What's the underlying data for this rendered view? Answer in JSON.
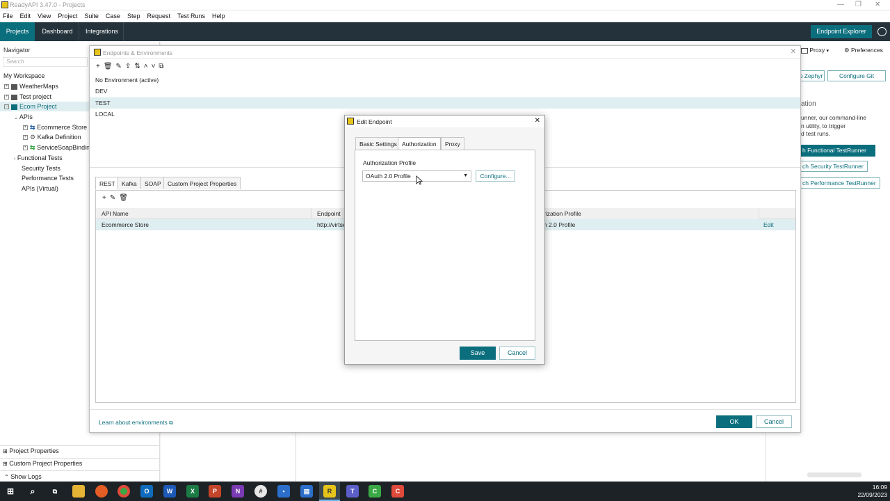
{
  "window": {
    "title": "ReadyAPI 3.47.0 - Projects"
  },
  "menu": [
    "File",
    "Edit",
    "View",
    "Project",
    "Suite",
    "Case",
    "Step",
    "Request",
    "Test Runs",
    "Help"
  ],
  "topnav": {
    "tabs": [
      "Projects",
      "Dashboard",
      "Integrations"
    ],
    "endpoint_explorer": "Endpoint Explorer"
  },
  "navigator": {
    "title": "Navigator",
    "search_placeholder": "Search",
    "workspace": "My Workspace",
    "projects": [
      "WeatherMaps",
      "Test project",
      "Ecom Project"
    ],
    "apis_label": "APIs",
    "apis": [
      "Ecommerce Store",
      "Kafka Definition",
      "ServiceSoapBindin"
    ],
    "sections": [
      "Functional Tests",
      "Security Tests",
      "Performance Tests",
      "APIs (Virtual)"
    ],
    "bottom": [
      "Project Properties",
      "Custom Project Properties",
      "Show Logs"
    ]
  },
  "right_panel": {
    "proxy": "Proxy",
    "preferences": "Preferences",
    "zephyr": "o Zephyr",
    "configure_git": "Configure Git",
    "heading": "ation",
    "text": [
      "unner, our command-line",
      "n utility, to trigger",
      "d test runs."
    ],
    "buttons": [
      "h Functional TestRunner",
      "ch Security TestRunner",
      "ch Performance TestRunner"
    ]
  },
  "ee_dialog": {
    "title": "Endpoints & Environments",
    "environments": [
      "No Environment (active)",
      "DEV",
      "TEST",
      "LOCAL"
    ],
    "tabs": [
      "REST",
      "Kafka",
      "SOAP",
      "Custom Project Properties"
    ],
    "columns": [
      "API Name",
      "Endpoint",
      "rization Profile"
    ],
    "row": {
      "api": "Ecommerce Store",
      "endpoint": "http://virtse",
      "profile": "h 2.0 Profile",
      "edit": "Edit"
    },
    "learn": "Learn about environments",
    "ok": "OK",
    "cancel": "Cancel"
  },
  "edit_dialog": {
    "title": "Edit Endpoint",
    "tabs": [
      "Basic Settings",
      "Authorization",
      "Proxy"
    ],
    "auth_label": "Authorization Profile",
    "auth_value": "OAuth 2.0 Profile",
    "configure": "Configure...",
    "save": "Save",
    "cancel": "Cancel"
  },
  "clock": {
    "time": "16:09",
    "date": "22/09/2023"
  },
  "colors": {
    "accent": "#0b6e7d",
    "nav_dark": "#23323b",
    "selected_row": "#dfeef0"
  }
}
